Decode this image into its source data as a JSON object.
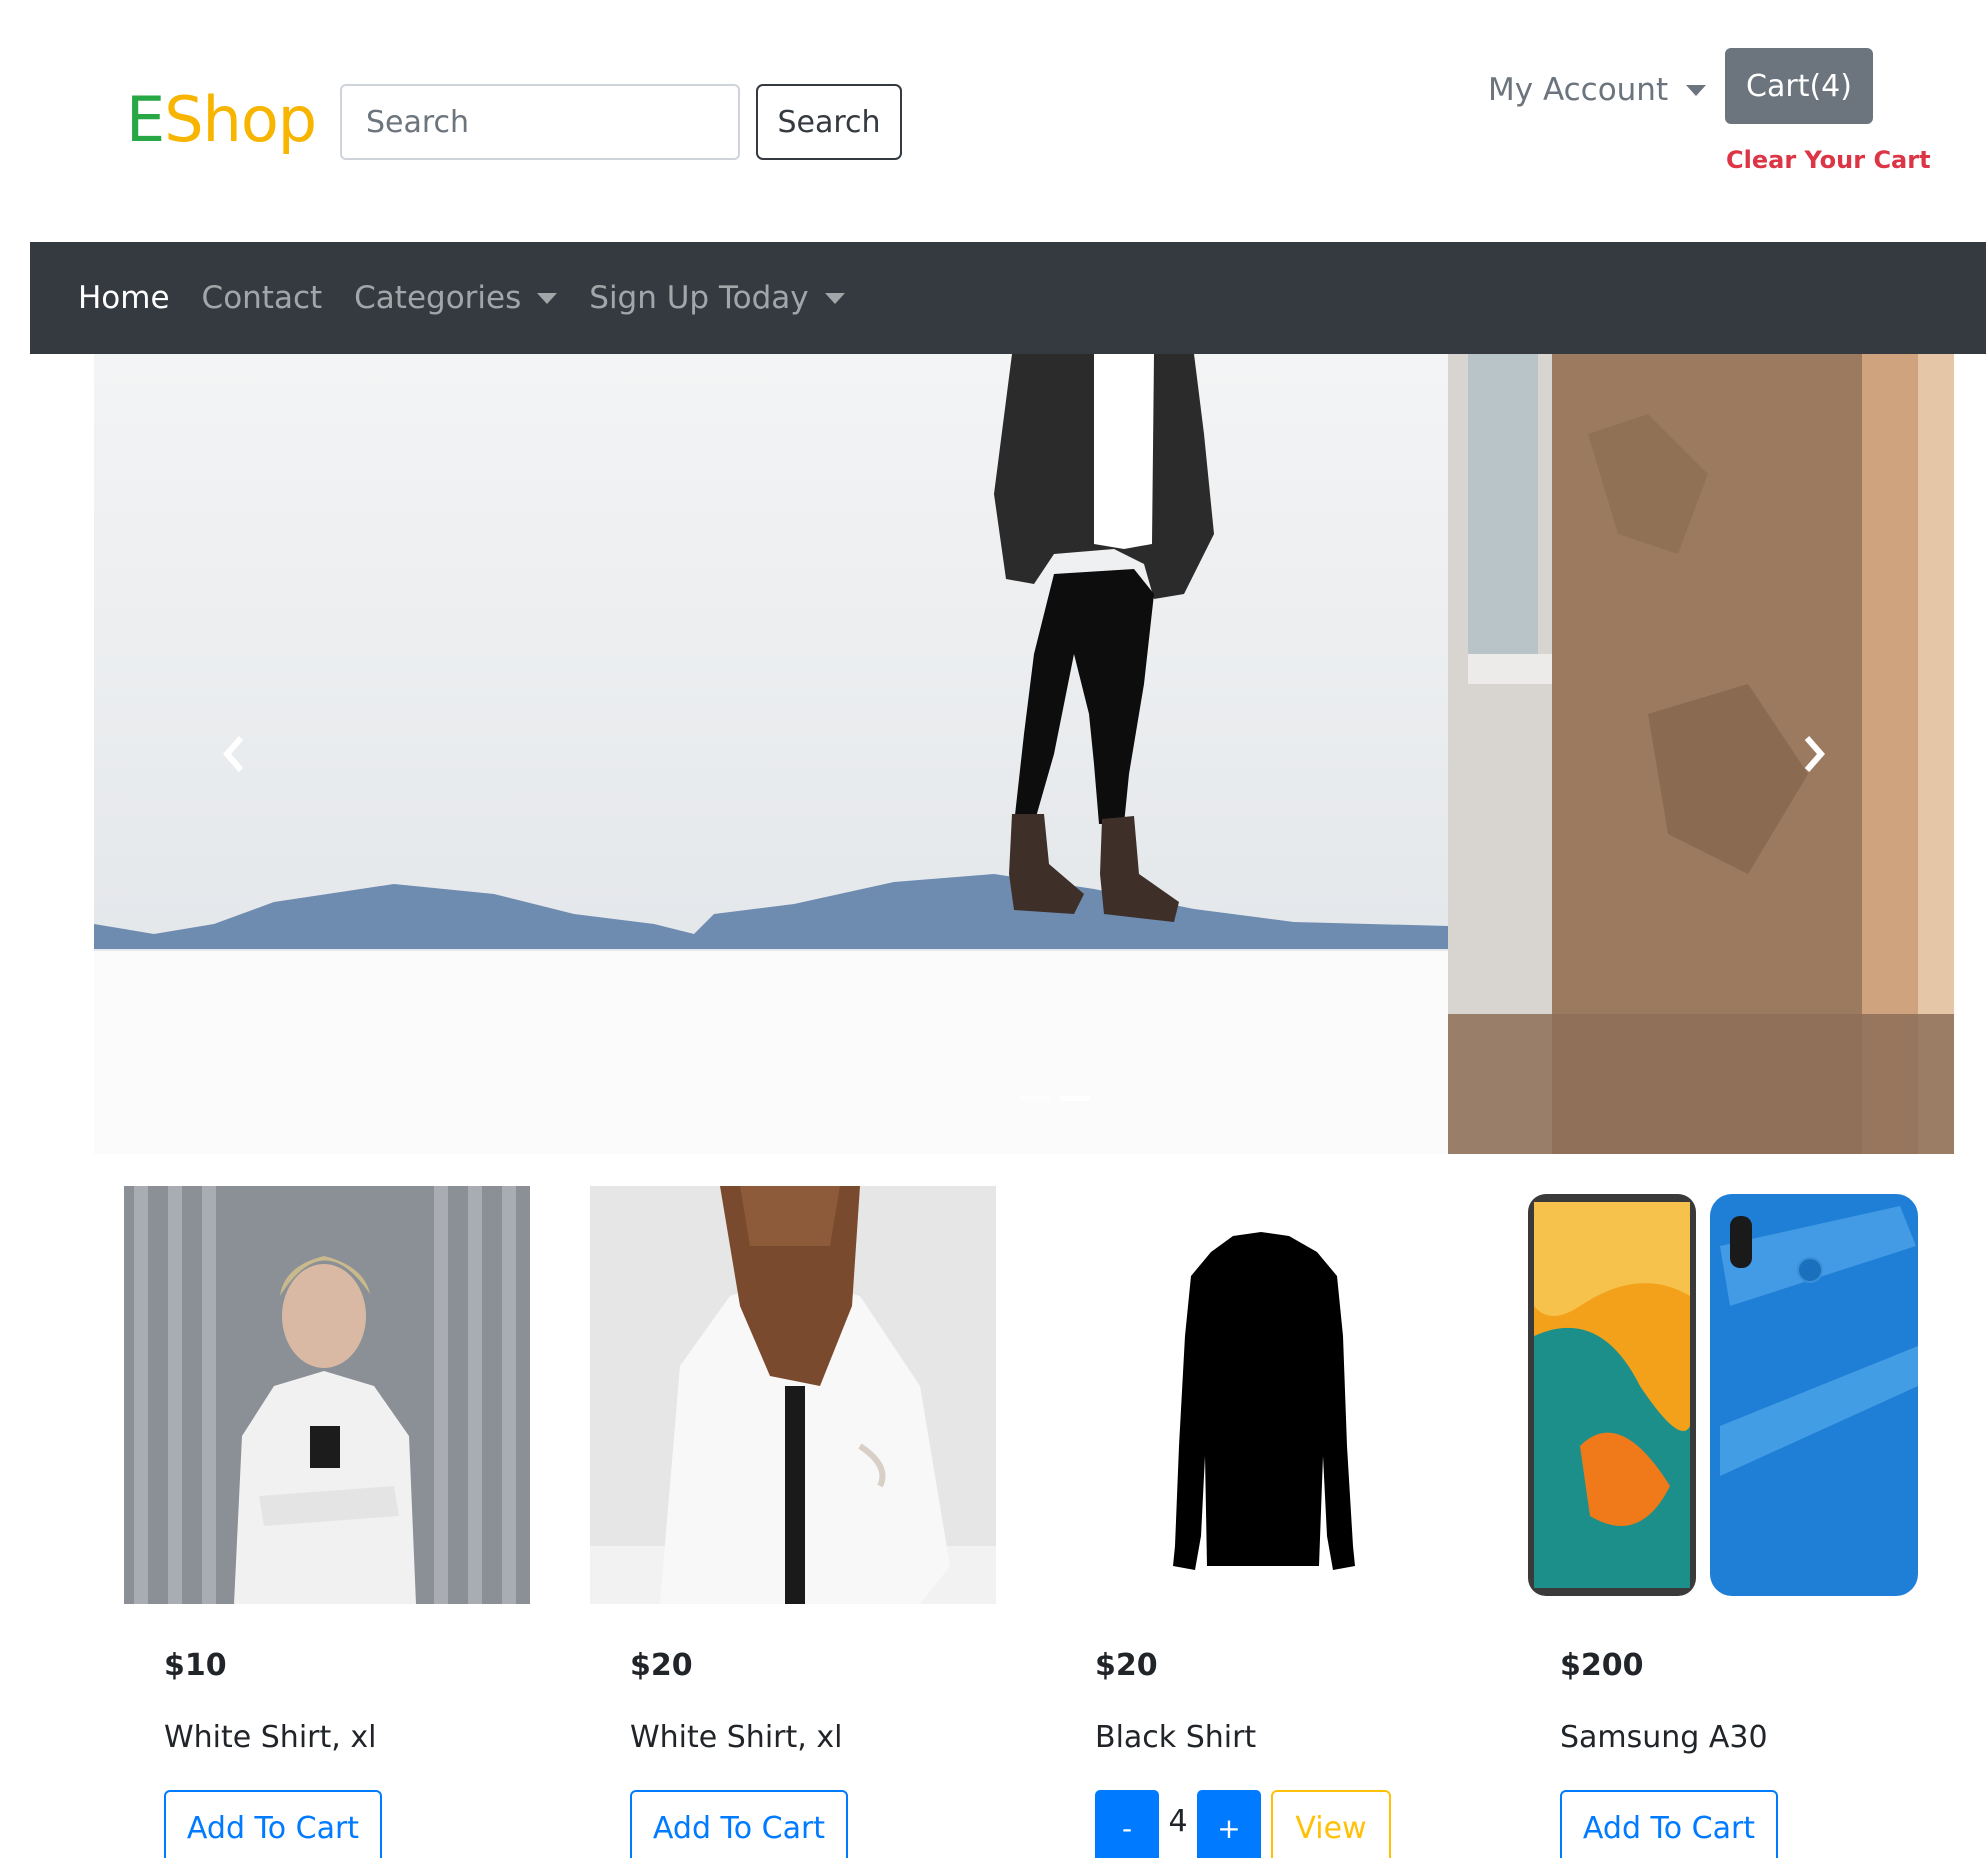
{
  "header": {
    "logo_first": "E",
    "logo_rest": "Shop",
    "search_placeholder": "Search",
    "search_button": "Search",
    "account_label": "My Account",
    "cart_label": "Cart(4)",
    "clear_cart": "Clear Your Cart"
  },
  "colors": {
    "logo_green": "#28a745",
    "logo_yellow": "#f7b500",
    "navbar_bg": "#343a40",
    "primary": "#007bff",
    "danger": "#dc3545",
    "warning": "#ffc107",
    "cart_bg": "#6c757d"
  },
  "navbar": {
    "items": [
      {
        "label": "Home"
      },
      {
        "label": "Contact"
      },
      {
        "label": "Categories"
      },
      {
        "label": "Sign Up Today"
      }
    ]
  },
  "carousel": {
    "prev_icon": "chevron-left-icon",
    "next_icon": "chevron-right-icon",
    "indicator_count": 2,
    "active_indicator": 1
  },
  "products": [
    {
      "price": "$10",
      "name": "White Shirt, xl",
      "action": "Add To Cart"
    },
    {
      "price": "$20",
      "name": "White Shirt, xl",
      "action": "Add To Cart"
    },
    {
      "price": "$20",
      "name": "Black Shirt",
      "qty_minus": "-",
      "qty": "4",
      "qty_plus": "+",
      "view": "View"
    },
    {
      "price": "$200",
      "name": "Samsung A30",
      "action": "Add To Cart"
    }
  ]
}
